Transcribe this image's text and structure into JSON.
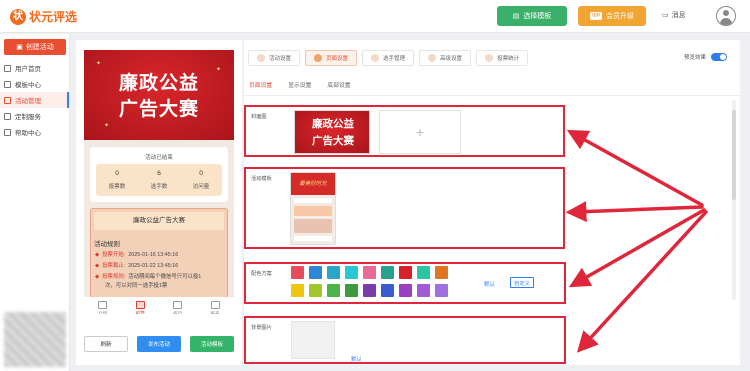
{
  "header": {
    "logo_mark": "状",
    "logo_text": "状元评选",
    "template_button": "选择模板",
    "vip_badge": "VIP",
    "vip_button": "会员升级",
    "message": "消息"
  },
  "sidebar": {
    "create_button": "创建活动",
    "items": [
      {
        "label": "用户首页"
      },
      {
        "label": "模板中心"
      },
      {
        "label": "活动管理"
      },
      {
        "label": "定制服务"
      },
      {
        "label": "帮助中心"
      }
    ],
    "active_index": 2
  },
  "preview": {
    "banner_line1": "廉政公益",
    "banner_line2": "广告大赛",
    "stats_header": "活动已结束",
    "stats": [
      {
        "value": "0",
        "label": "投票数"
      },
      {
        "value": "6",
        "label": "选手数"
      },
      {
        "value": "0",
        "label": "访问量"
      }
    ],
    "activity_title": "廉政公益广告大赛",
    "rules_heading": "活动规则",
    "rules": [
      {
        "key": "投票开始:",
        "text": "2025-01-16 13:45:16"
      },
      {
        "key": "投票截止:",
        "text": "2025-01-22 13:45:16"
      },
      {
        "key": "投票规则:",
        "text": "活动期间每个微信号只可以投1"
      },
      {
        "key": "",
        "text": "次，可以对同一选手投1票"
      }
    ],
    "tabs": [
      "介绍",
      "投票",
      "排行",
      "报名"
    ],
    "active_tab": 1,
    "buttons": {
      "refresh": "刷新",
      "publish": "发布活动",
      "template": "活动模板"
    }
  },
  "settings": {
    "steps": [
      "活动设置",
      "页面设置",
      "选手管理",
      "高级设置",
      "投票统计"
    ],
    "active_step": 1,
    "preview_toggle_label": "预览效果",
    "preview_toggle_on": true,
    "subtabs": [
      "页面设置",
      "显示设置",
      "底部设置"
    ],
    "active_subtab": 0,
    "cover": {
      "label": "封面图",
      "thumb_line1": "廉政公益",
      "thumb_line2": "广告大赛",
      "upload_symbol": "+"
    },
    "template": {
      "label": "活动模板",
      "thumb_title": "最美好时光"
    },
    "colors": {
      "label": "配色方案",
      "swatches": [
        "#e74c5b",
        "#2f86d8",
        "#2aa6c9",
        "#27c7d4",
        "#e86a95",
        "#27a08d",
        "#d9212b",
        "#2cc5a4",
        "#e07420",
        "#f0c613",
        "#a1c72b",
        "#4db348",
        "#3c9a3c",
        "#7b3ea8",
        "#3b5bd1",
        "#9c3fc5",
        "#a15bd8",
        "#9f71e0"
      ],
      "default_link": "默认",
      "custom_button": "自定义"
    },
    "background": {
      "label": "背景图片",
      "default_link": "默认"
    }
  },
  "annotation_color": "#e0263a"
}
